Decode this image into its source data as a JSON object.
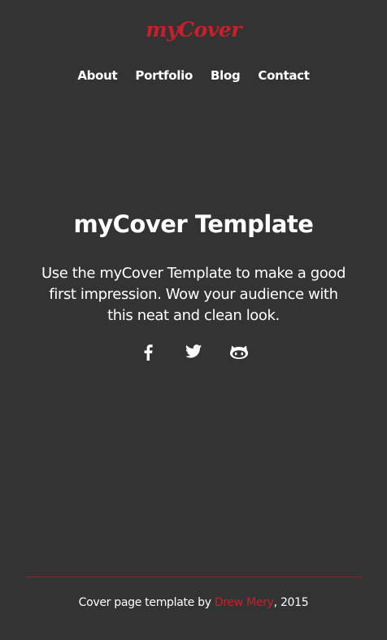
{
  "header": {
    "brand": "myCover"
  },
  "nav": {
    "items": [
      {
        "label": "About"
      },
      {
        "label": "Portfolio"
      },
      {
        "label": "Blog"
      },
      {
        "label": "Contact"
      }
    ]
  },
  "hero": {
    "title": "myCover Template",
    "lead": "Use the myCover Template to make a good first impression. Wow your audience with this neat and clean look."
  },
  "social": {
    "icons": [
      "facebook-icon",
      "twitter-icon",
      "github-icon"
    ]
  },
  "footer": {
    "text_prefix": "Cover page template by ",
    "author": "Drew Mery",
    "text_suffix": ", 2015"
  },
  "colors": {
    "background": "#333333",
    "accent": "#c8202a",
    "text": "#ffffff"
  }
}
